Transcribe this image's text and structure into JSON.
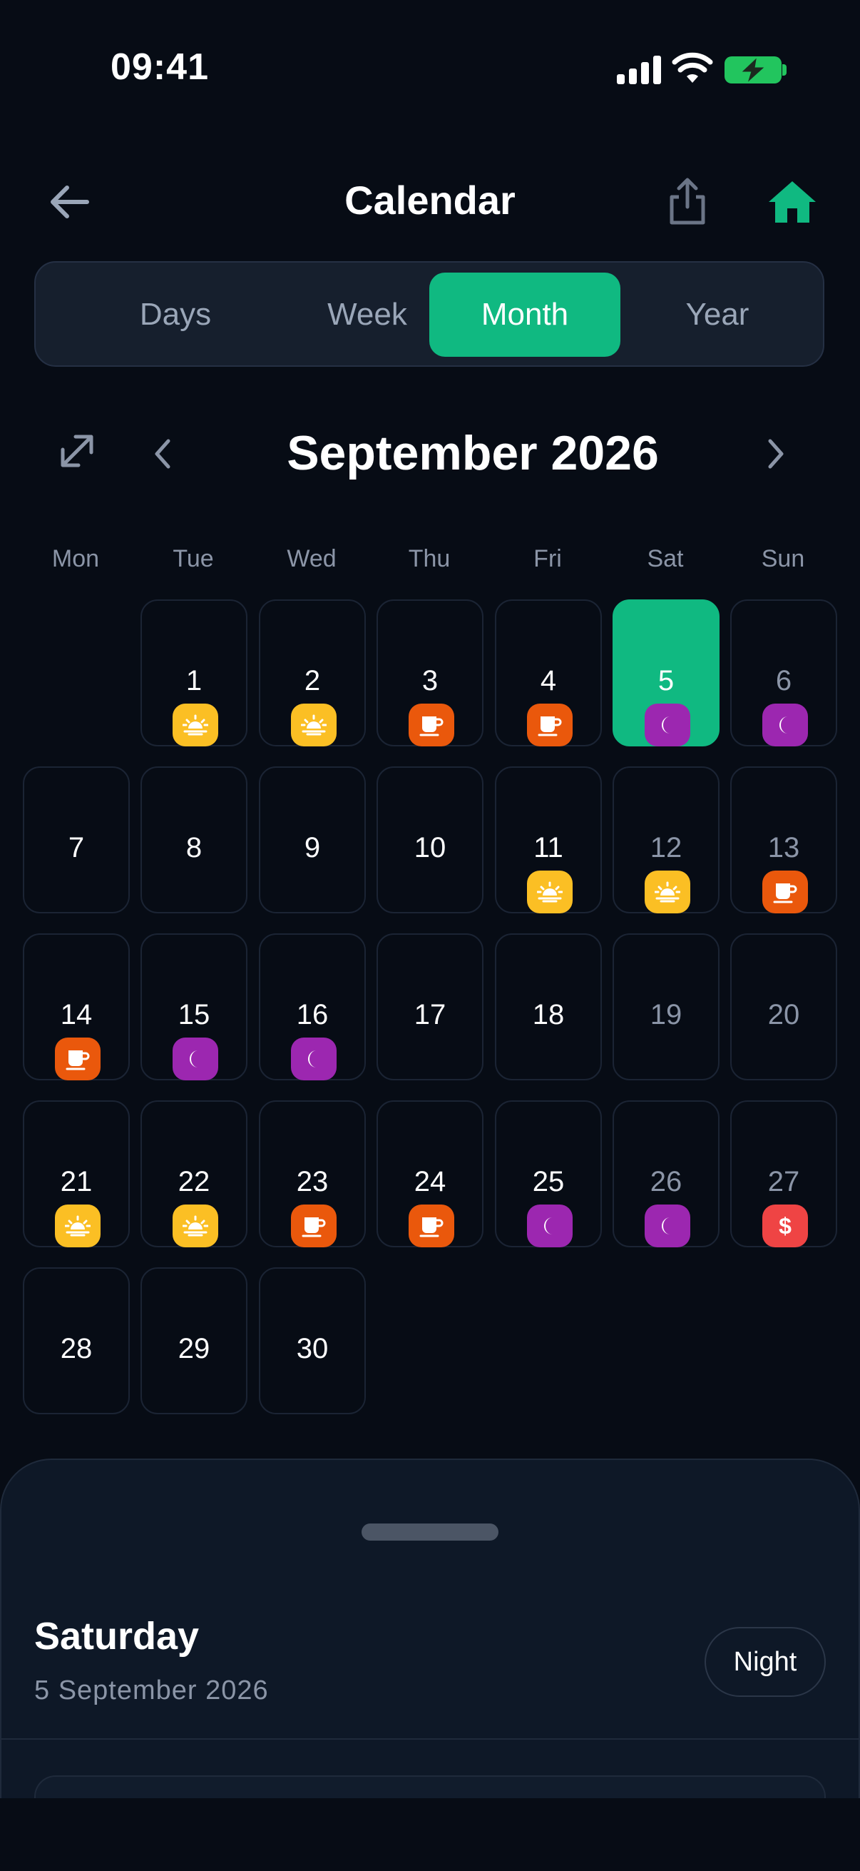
{
  "status_bar": {
    "time": "09:41"
  },
  "header": {
    "title": "Calendar",
    "back_icon": "arrow-left-icon",
    "share_icon": "share-icon",
    "home_icon": "home-icon",
    "accent_color": "#10b981"
  },
  "view_tabs": [
    {
      "label": "Days",
      "active": false
    },
    {
      "label": "Week",
      "active": false
    },
    {
      "label": "Month",
      "active": true
    },
    {
      "label": "Year",
      "active": false
    }
  ],
  "month_nav": {
    "title": "September 2026"
  },
  "weekdays": [
    "Mon",
    "Tue",
    "Wed",
    "Thu",
    "Fri",
    "Sat",
    "Sun"
  ],
  "shift_types": {
    "day": {
      "icon": "sunrise-icon",
      "color": "#fbbf24"
    },
    "break": {
      "icon": "coffee-cup-icon",
      "color": "#ea580c"
    },
    "night": {
      "icon": "moon-icon",
      "color": "#9c27b0"
    },
    "pay": {
      "icon": "dollar-icon",
      "color": "#ef4444"
    }
  },
  "days": [
    {
      "label": "1",
      "shift": "day"
    },
    {
      "label": "2",
      "shift": "day"
    },
    {
      "label": "3",
      "shift": "break"
    },
    {
      "label": "4",
      "shift": "break"
    },
    {
      "label": "5",
      "shift": "night",
      "selected": true
    },
    {
      "label": "6",
      "shift": "night"
    },
    {
      "label": "7"
    },
    {
      "label": "8"
    },
    {
      "label": "9"
    },
    {
      "label": "10"
    },
    {
      "label": "11",
      "shift": "day"
    },
    {
      "label": "12",
      "shift": "day"
    },
    {
      "label": "13",
      "shift": "break"
    },
    {
      "label": "14",
      "shift": "break"
    },
    {
      "label": "15",
      "shift": "night"
    },
    {
      "label": "16",
      "shift": "night"
    },
    {
      "label": "17"
    },
    {
      "label": "18"
    },
    {
      "label": "19"
    },
    {
      "label": "20"
    },
    {
      "label": "21",
      "shift": "day"
    },
    {
      "label": "22",
      "shift": "day"
    },
    {
      "label": "23",
      "shift": "break"
    },
    {
      "label": "24",
      "shift": "break"
    },
    {
      "label": "25",
      "shift": "night"
    },
    {
      "label": "26",
      "shift": "night"
    },
    {
      "label": "27",
      "shift": "pay"
    },
    {
      "label": "28"
    },
    {
      "label": "29"
    },
    {
      "label": "30"
    }
  ],
  "first_weekday_index": 1,
  "detail_sheet": {
    "weekday": "Saturday",
    "date": "5 September 2026",
    "shift_label": "Night"
  }
}
